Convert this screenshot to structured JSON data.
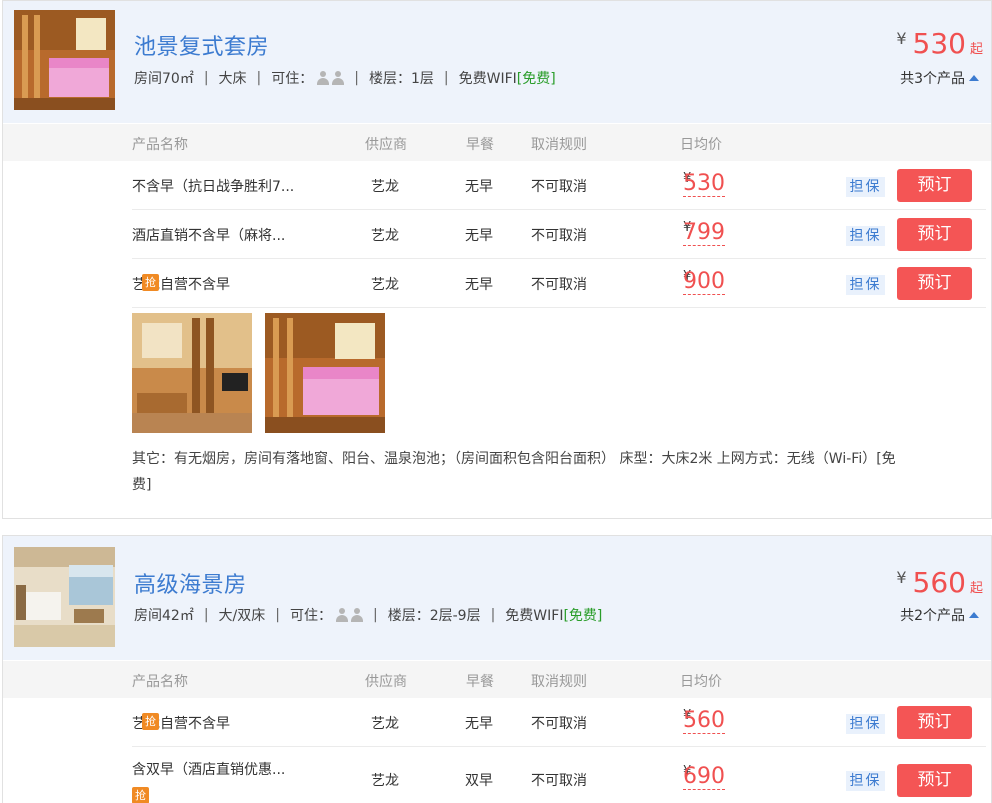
{
  "rooms": [
    {
      "name": "池景复式套房",
      "area": "房间70㎡",
      "bed": "大床",
      "occupancy_label": "可住：",
      "floor": "楼层：1层",
      "wifi": "免费WIFI",
      "wifi_tag": "[免费]",
      "price_currency": "¥",
      "price": "530",
      "price_suffix": "起",
      "product_count": "共3个产品",
      "table_header": {
        "name": "产品名称",
        "supplier": "供应商",
        "breakfast": "早餐",
        "cancel": "取消规则",
        "price": "日均价"
      },
      "products": [
        {
          "name": "不含早（抗日战争胜利7...",
          "qiang": "",
          "supplier": "艺龙",
          "breakfast": "无早",
          "cancel": "不可取消",
          "price": "530",
          "guarantee": "担保",
          "book": "预订"
        },
        {
          "name": "酒店直销不含早（麻将...",
          "qiang": "",
          "supplier": "艺龙",
          "breakfast": "无早",
          "cancel": "不可取消",
          "price": "799",
          "guarantee": "担保",
          "book": "预订"
        },
        {
          "name": "艺龙自营不含早",
          "qiang": "抢",
          "supplier": "艺龙",
          "breakfast": "无早",
          "cancel": "不可取消",
          "price": "900",
          "guarantee": "担保",
          "book": "预订"
        }
      ],
      "other_info": "其它：有无烟房，房间有落地窗、阳台、温泉泡池；（房间面积包含阳台面积） 床型：大床2米 上网方式：无线（Wi-Fi）[免费]"
    },
    {
      "name": "高级海景房",
      "area": "房间42㎡",
      "bed": "大/双床",
      "occupancy_label": "可住：",
      "floor": "楼层：2层-9层",
      "wifi": "免费WIFI",
      "wifi_tag": "[免费]",
      "price_currency": "¥",
      "price": "560",
      "price_suffix": "起",
      "product_count": "共2个产品",
      "table_header": {
        "name": "产品名称",
        "supplier": "供应商",
        "breakfast": "早餐",
        "cancel": "取消规则",
        "price": "日均价"
      },
      "products": [
        {
          "name": "艺龙自营不含早",
          "qiang": "抢",
          "supplier": "艺龙",
          "breakfast": "无早",
          "cancel": "不可取消",
          "price": "560",
          "guarantee": "担保",
          "book": "预订"
        },
        {
          "name": "含双早（酒店直销优惠...",
          "qiang": "抢",
          "supplier": "艺龙",
          "breakfast": "双早",
          "cancel": "不可取消",
          "price": "690",
          "guarantee": "担保",
          "book": "预订"
        }
      ]
    }
  ],
  "currency_symbol": "¥",
  "colors": {
    "accent_blue": "#3c7bd0",
    "price_red": "#f05050",
    "book_red": "#f45555",
    "free_green": "#2a9d2a",
    "qiang_orange": "#f08a24"
  }
}
